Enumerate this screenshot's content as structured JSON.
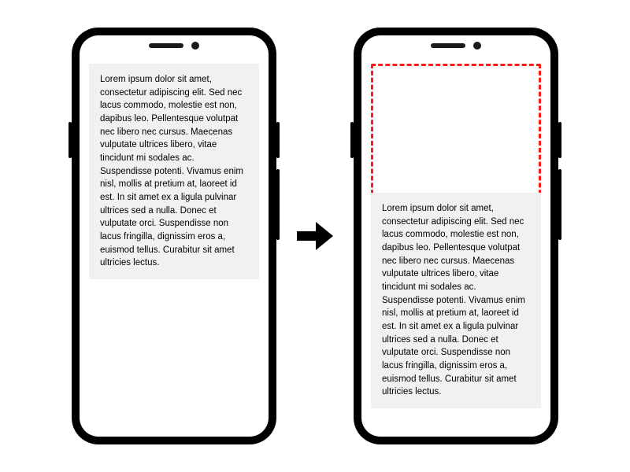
{
  "lorem_text": "Lorem ipsum dolor sit amet, consectetur adipiscing elit. Sed nec lacus commodo, molestie est non, dapibus leo. Pellentesque volutpat nec libero nec cursus. Maecenas vulputate ultrices libero, vitae tincidunt mi sodales ac. Suspendisse potenti. Vivamus enim nisl, mollis at pretium at, laoreet id est. In sit amet ex a ligula pulvinar ultrices sed a nulla. Donec et vulputate orci. Suspendisse non lacus fringilla, dignissim eros a, euismod tellus. Curabitur sit amet ultricies lectus.",
  "colors": {
    "highlight": "#ff1a1a",
    "text_bg": "#f1f1f1"
  }
}
